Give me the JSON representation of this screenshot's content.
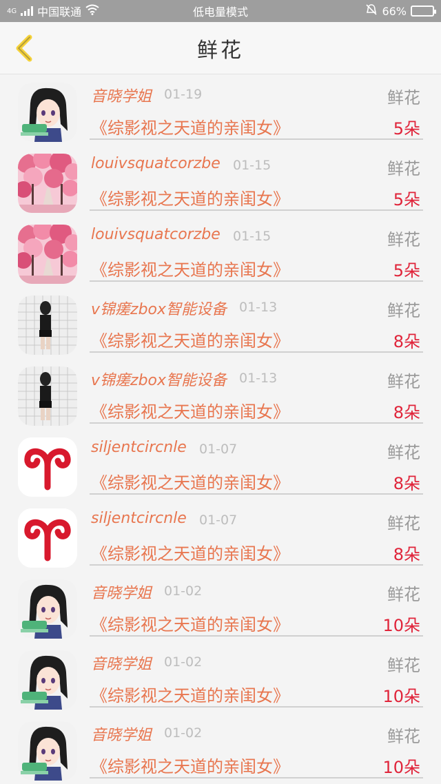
{
  "status_bar": {
    "network": "4G",
    "carrier": "中国联通",
    "mode": "低电量模式",
    "battery": "66%",
    "battery_level": 0.66
  },
  "header": {
    "title": "鲜花"
  },
  "rows": [
    {
      "user": "音晓学姐",
      "date": "01-19",
      "gift": "鲜花",
      "book": "《综影视之天道的亲闺女》",
      "count": "5朵",
      "avatar": "anime-girl"
    },
    {
      "user": "louivsquatcorzbe",
      "date": "01-15",
      "gift": "鲜花",
      "book": "《综影视之天道的亲闺女》",
      "count": "5朵",
      "avatar": "cherry-blossom"
    },
    {
      "user": "louivsquatcorzbe",
      "date": "01-15",
      "gift": "鲜花",
      "book": "《综影视之天道的亲闺女》",
      "count": "5朵",
      "avatar": "cherry-blossom"
    },
    {
      "user": "v锦瘥zbox智能设备",
      "date": "01-13",
      "gift": "鲜花",
      "book": "《综影视之天道的亲闺女》",
      "count": "8朵",
      "avatar": "mirror-selfie"
    },
    {
      "user": "v锦瘥zbox智能设备",
      "date": "01-13",
      "gift": "鲜花",
      "book": "《综影视之天道的亲闺女》",
      "count": "8朵",
      "avatar": "mirror-selfie"
    },
    {
      "user": "siljentcircnle",
      "date": "01-07",
      "gift": "鲜花",
      "book": "《综影视之天道的亲闺女》",
      "count": "8朵",
      "avatar": "aries-symbol"
    },
    {
      "user": "siljentcircnle",
      "date": "01-07",
      "gift": "鲜花",
      "book": "《综影视之天道的亲闺女》",
      "count": "8朵",
      "avatar": "aries-symbol"
    },
    {
      "user": "音晓学姐",
      "date": "01-02",
      "gift": "鲜花",
      "book": "《综影视之天道的亲闺女》",
      "count": "10朵",
      "avatar": "anime-girl"
    },
    {
      "user": "音晓学姐",
      "date": "01-02",
      "gift": "鲜花",
      "book": "《综影视之天道的亲闺女》",
      "count": "10朵",
      "avatar": "anime-girl"
    },
    {
      "user": "音晓学姐",
      "date": "01-02",
      "gift": "鲜花",
      "book": "《综影视之天道的亲闺女》",
      "count": "10朵",
      "avatar": "anime-girl"
    }
  ],
  "colors": {
    "accent": "#e8764f",
    "count": "#e0243a",
    "back_icon": "#f5d23a",
    "status_bar": "#9e9e9e"
  }
}
